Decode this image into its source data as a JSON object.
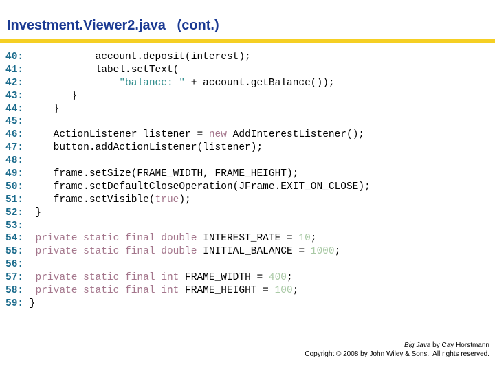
{
  "slide": {
    "title": "Investment.Viewer2.java   (cont.)",
    "rule_color": "#F5CF23",
    "title_color": "#1B3A93"
  },
  "syntax_colors": {
    "lineno": "#1B6B8C",
    "plain": "#000000",
    "keyword": "#A4768C",
    "string": "#2F8C8C",
    "number": "#A9C9A5"
  },
  "code": {
    "language": "java",
    "first_line": 40,
    "last_line": 59,
    "lines": [
      {
        "number": "40:",
        "tokens": [
          {
            "t": "plain",
            "s": "            account.deposit(interest);"
          }
        ]
      },
      {
        "number": "41:",
        "tokens": [
          {
            "t": "plain",
            "s": "            label.setText("
          }
        ]
      },
      {
        "number": "42:",
        "tokens": [
          {
            "t": "plain",
            "s": "                "
          },
          {
            "t": "string",
            "s": "\"balance: \""
          },
          {
            "t": "plain",
            "s": " + account.getBalance());"
          }
        ]
      },
      {
        "number": "43:",
        "tokens": [
          {
            "t": "plain",
            "s": "        }"
          }
        ]
      },
      {
        "number": "44:",
        "tokens": [
          {
            "t": "plain",
            "s": "     }"
          }
        ]
      },
      {
        "number": "45:",
        "tokens": [
          {
            "t": "plain",
            "s": ""
          }
        ]
      },
      {
        "number": "46:",
        "tokens": [
          {
            "t": "plain",
            "s": "     ActionListener listener = "
          },
          {
            "t": "keyword",
            "s": "new"
          },
          {
            "t": "plain",
            "s": " AddInterestListener();"
          }
        ]
      },
      {
        "number": "47:",
        "tokens": [
          {
            "t": "plain",
            "s": "     button.addActionListener(listener);"
          }
        ]
      },
      {
        "number": "48:",
        "tokens": [
          {
            "t": "plain",
            "s": ""
          }
        ]
      },
      {
        "number": "49:",
        "tokens": [
          {
            "t": "plain",
            "s": "     frame.setSize(FRAME_WIDTH, FRAME_HEIGHT);"
          }
        ]
      },
      {
        "number": "50:",
        "tokens": [
          {
            "t": "plain",
            "s": "     frame.setDefaultCloseOperation(JFrame.EXIT_ON_CLOSE);"
          }
        ]
      },
      {
        "number": "51:",
        "tokens": [
          {
            "t": "plain",
            "s": "     frame.setVisible("
          },
          {
            "t": "keyword",
            "s": "true"
          },
          {
            "t": "plain",
            "s": ");"
          }
        ]
      },
      {
        "number": "52:",
        "tokens": [
          {
            "t": "plain",
            "s": "  }"
          }
        ]
      },
      {
        "number": "53:",
        "tokens": [
          {
            "t": "plain",
            "s": ""
          }
        ]
      },
      {
        "number": "54:",
        "tokens": [
          {
            "t": "keyword",
            "s": "  private static final double"
          },
          {
            "t": "plain",
            "s": " INTEREST_RATE = "
          },
          {
            "t": "number",
            "s": "10"
          },
          {
            "t": "plain",
            "s": ";"
          }
        ]
      },
      {
        "number": "55:",
        "tokens": [
          {
            "t": "keyword",
            "s": "  private static final double"
          },
          {
            "t": "plain",
            "s": " INITIAL_BALANCE = "
          },
          {
            "t": "number",
            "s": "1000"
          },
          {
            "t": "plain",
            "s": ";"
          }
        ]
      },
      {
        "number": "56:",
        "tokens": [
          {
            "t": "plain",
            "s": ""
          }
        ]
      },
      {
        "number": "57:",
        "tokens": [
          {
            "t": "keyword",
            "s": "  private static final int"
          },
          {
            "t": "plain",
            "s": " FRAME_WIDTH = "
          },
          {
            "t": "number",
            "s": "400"
          },
          {
            "t": "plain",
            "s": ";"
          }
        ]
      },
      {
        "number": "58:",
        "tokens": [
          {
            "t": "keyword",
            "s": "  private static final int"
          },
          {
            "t": "plain",
            "s": " FRAME_HEIGHT = "
          },
          {
            "t": "number",
            "s": "100"
          },
          {
            "t": "plain",
            "s": ";"
          }
        ]
      },
      {
        "number": "59:",
        "tokens": [
          {
            "t": "plain",
            "s": " }"
          }
        ]
      }
    ]
  },
  "footer": {
    "book_title": "Big Java",
    "credit_suffix": " by Cay Horstmann",
    "copyright": "Copyright © 2008 by John Wiley & Sons.  All rights reserved."
  }
}
